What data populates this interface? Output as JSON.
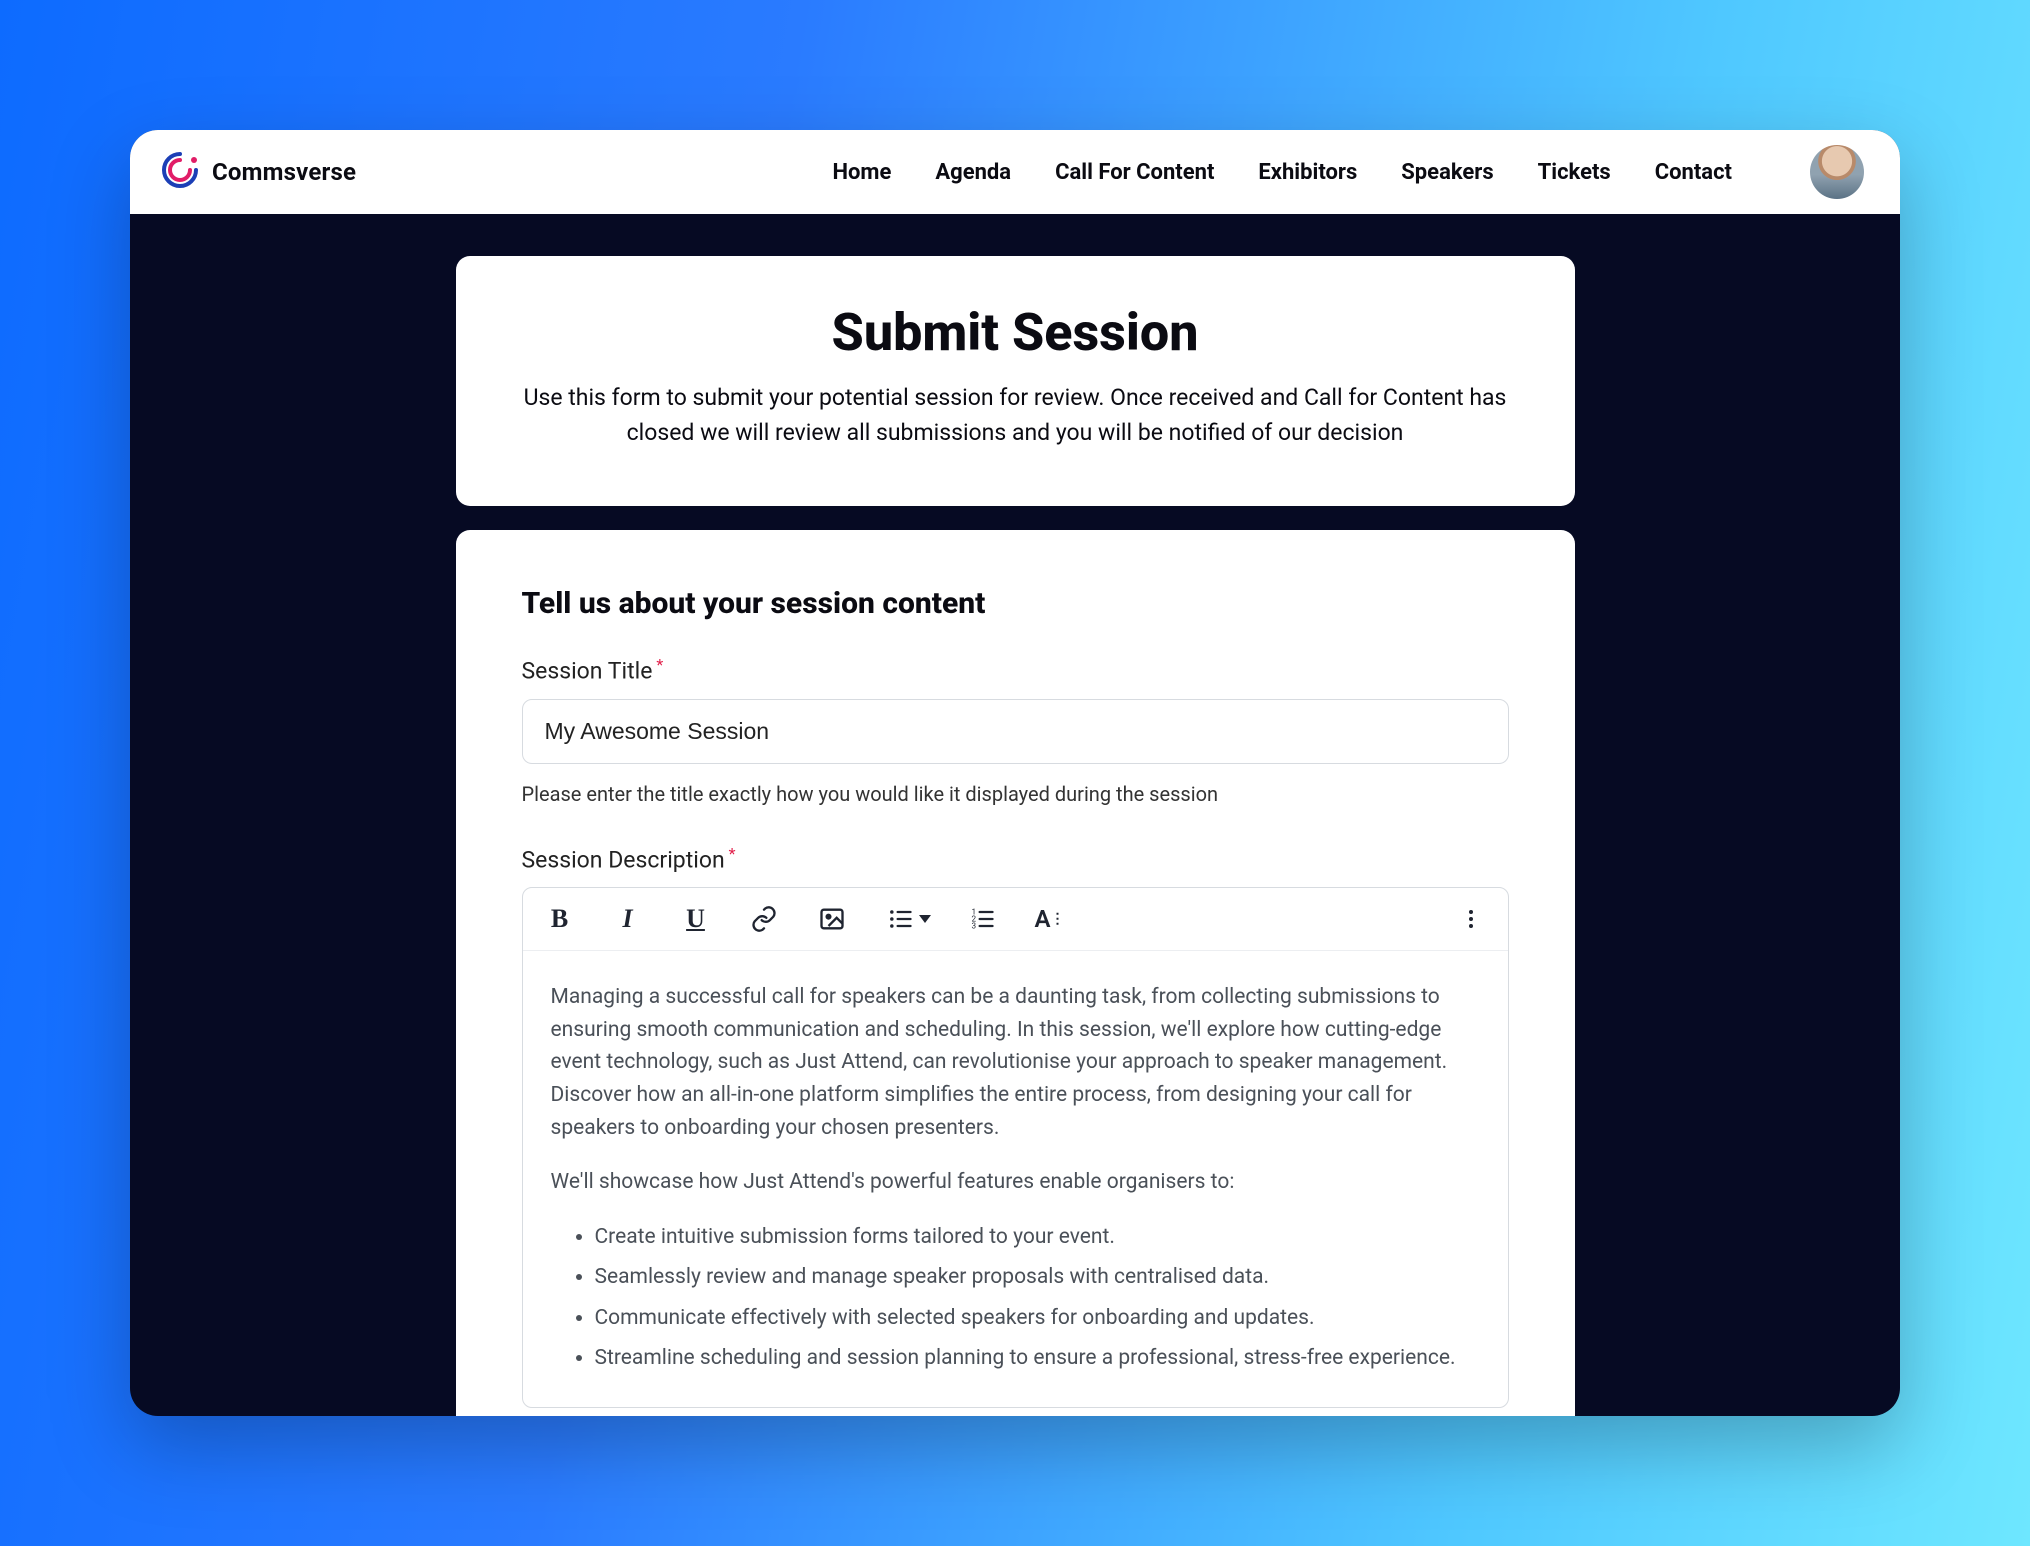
{
  "brand": {
    "name": "Commsverse"
  },
  "nav": {
    "items": [
      {
        "label": "Home"
      },
      {
        "label": "Agenda"
      },
      {
        "label": "Call For Content"
      },
      {
        "label": "Exhibitors"
      },
      {
        "label": "Speakers"
      },
      {
        "label": "Tickets"
      },
      {
        "label": "Contact"
      }
    ]
  },
  "intro": {
    "title": "Submit Session",
    "body": "Use this form to submit your potential session for review. Once received and Call for Content has closed we will review all submissions and you will be notified of our decision"
  },
  "form": {
    "section_heading": "Tell us about your session content",
    "title_field": {
      "label": "Session Title",
      "required_mark": "*",
      "value": "My Awesome Session",
      "helper": "Please enter the title exactly how you would like it displayed during the session"
    },
    "description_field": {
      "label": "Session Description",
      "required_mark": "*",
      "paragraph1": "Managing a successful call for speakers can be a daunting task, from collecting submissions to ensuring smooth communication and scheduling. In this session, we'll explore how cutting-edge event technology, such as Just Attend, can revolutionise your approach to speaker management. Discover how an all-in-one platform simplifies the entire process, from designing your call for speakers to onboarding your chosen presenters.",
      "paragraph2": "We'll showcase how Just Attend's powerful features enable organisers to:",
      "bullets": [
        "Create intuitive submission forms tailored to your event.",
        "Seamlessly review and manage speaker proposals with centralised data.",
        "Communicate effectively with selected speakers for onboarding and updates.",
        "Streamline scheduling and session planning to ensure a professional, stress-free experience."
      ]
    }
  },
  "toolbar_icons": {
    "bold": "B",
    "italic": "I",
    "underline": "U",
    "font": "A"
  }
}
